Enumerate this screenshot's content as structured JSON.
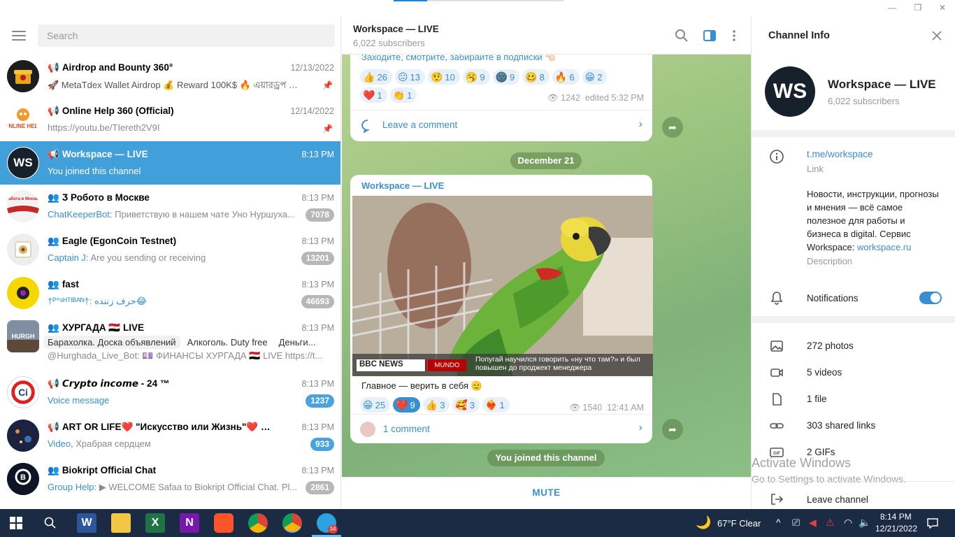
{
  "search": {
    "placeholder": "Search"
  },
  "chats": [
    {
      "name": "Airdrop and Bounty 360°",
      "time": "12/13/2022",
      "preview": "🚀 MetaTdex Wallet Airdrop 💰 Reward 100K$ 🔥 এয়ারড্রপ পু...",
      "pinned": true
    },
    {
      "name": "Online Help 360 (Official)",
      "time": "12/14/2022",
      "preview": "https://youtu.be/TIereth2V9I",
      "pinned": true
    },
    {
      "name": "Workspace — LIVE",
      "time": "8:13 PM",
      "preview": "You joined this channel",
      "active": true
    },
    {
      "name": "Ӡ Робото в Москве",
      "time": "8:13 PM",
      "sender": "ChatKeeperBot:",
      "preview": " Приветствую в нашем чате Уно Нуршуха...",
      "badge": "7078"
    },
    {
      "name": "Eagle (EgonCoin Testnet)",
      "time": "8:13 PM",
      "sender": "Captain J:",
      "preview": " Are you sending or receiving",
      "badge": "13201"
    },
    {
      "name": "fast",
      "time": "8:13 PM",
      "preview": "†ᴾ°ˢᴴᵀᴵᴮᴬᴺ†: حرف زننده😂",
      "badge": "46693"
    },
    {
      "name": "ХУРГАДА 🇪🇬 LIVE",
      "time": "8:13 PM",
      "tags": [
        "Барахолка. Доска объявлений",
        "Алкоголь. Duty free",
        "Деньги..."
      ],
      "preview": "@Hurghada_Live_Bot: 💷 ФИНАНСЫ ХУРГАДА 🇪🇬 LIVE https://t..."
    },
    {
      "name": "𝘾𝙧𝙮𝙥𝙩𝙤 𝙞𝙣𝙘𝙤𝙢𝙚 - 24 ™",
      "time": "8:13 PM",
      "sender": "Voice message",
      "preview": "",
      "badge": "1237",
      "badgeBlue": true
    },
    {
      "name": "ART OR LIFE❤️ \"Искусство или Жизнь\"❤️ фильм \"...",
      "time": "8:13 PM",
      "sender": "Video,",
      "preview": " Храбрая сердцем",
      "badge": "933",
      "badgeBlue": true
    },
    {
      "name": "Biokript Official Chat",
      "time": "8:13 PM",
      "sender": "Group Help:",
      "preview": " ▶ WELCOME Safaa  to Biokript Official Chat. Pl...",
      "badge": "2861"
    }
  ],
  "header": {
    "title": "Workspace — LIVE",
    "subscribers": "6,022 subscribers"
  },
  "post1": {
    "text_tail": "Заходите, смотрите, забирайте в подписки 👈🏻",
    "reactions": [
      {
        "emoji": "👍",
        "count": "26"
      },
      {
        "emoji": "😐",
        "count": "13"
      },
      {
        "emoji": "🤨",
        "count": "10"
      },
      {
        "emoji": "🥱",
        "count": "9"
      },
      {
        "emoji": "🌚",
        "count": "9"
      },
      {
        "emoji": "🥴",
        "count": "8"
      },
      {
        "emoji": "🔥",
        "count": "6"
      },
      {
        "emoji": "😁",
        "count": "2"
      },
      {
        "emoji": "❤️",
        "count": "1"
      },
      {
        "emoji": "👏",
        "count": "1"
      }
    ],
    "views": "1242",
    "meta": "edited 5:32 PM",
    "comment_label": "Leave a comment"
  },
  "date_pill": "December 21",
  "post2": {
    "channel": "Workspace — LIVE",
    "image_caption_brand": "BBC NEWS",
    "image_caption_sub": "MUNDO",
    "image_caption_text": "Попугай научился говорить «ну что там?» и был повышен до проджект менеджера",
    "text": "Главное — верить в себя 🫡",
    "reactions": [
      {
        "emoji": "😁",
        "count": "25"
      },
      {
        "emoji": "❤️",
        "count": "9",
        "selected": true
      },
      {
        "emoji": "👍",
        "count": "3"
      },
      {
        "emoji": "🥰",
        "count": "3"
      },
      {
        "emoji": "❤️‍🔥",
        "count": "1"
      }
    ],
    "views": "1540",
    "time": "12:41 AM",
    "comment_label": "1 comment"
  },
  "joined_pill": "You joined this channel",
  "mute_label": "MUTE",
  "info": {
    "title": "Channel Info",
    "avatar_text": "WS",
    "name": "Workspace — LIVE",
    "subscribers": "6,022 subscribers",
    "link": "t.me/workspace",
    "link_label": "Link",
    "description": "Новости, инструкции, прогнозы и мнения — всё самое полезное для работы и бизнеса в digital. Сервис Workspace:",
    "description_link": "workspace.ru",
    "description_label": "Description",
    "notifications_label": "Notifications",
    "media": [
      {
        "label": "272 photos",
        "icon": "photo-icon"
      },
      {
        "label": "5 videos",
        "icon": "video-icon"
      },
      {
        "label": "1 file",
        "icon": "file-icon"
      },
      {
        "label": "303 shared links",
        "icon": "link-icon"
      },
      {
        "label": "2 GIFs",
        "icon": "gif-icon"
      }
    ],
    "leave_label": "Leave channel"
  },
  "watermark": {
    "line1": "Activate Windows",
    "line2": "Go to Settings to activate Windows."
  },
  "taskbar": {
    "weather": "67°F  Clear",
    "time": "8:14 PM",
    "date": "12/21/2022",
    "telegram_badge": "34"
  },
  "colors": {
    "accent": "#419fd9",
    "link": "#3a8fd0",
    "taskbar": "#1c2b44",
    "channel_avatar": "#17212b"
  }
}
